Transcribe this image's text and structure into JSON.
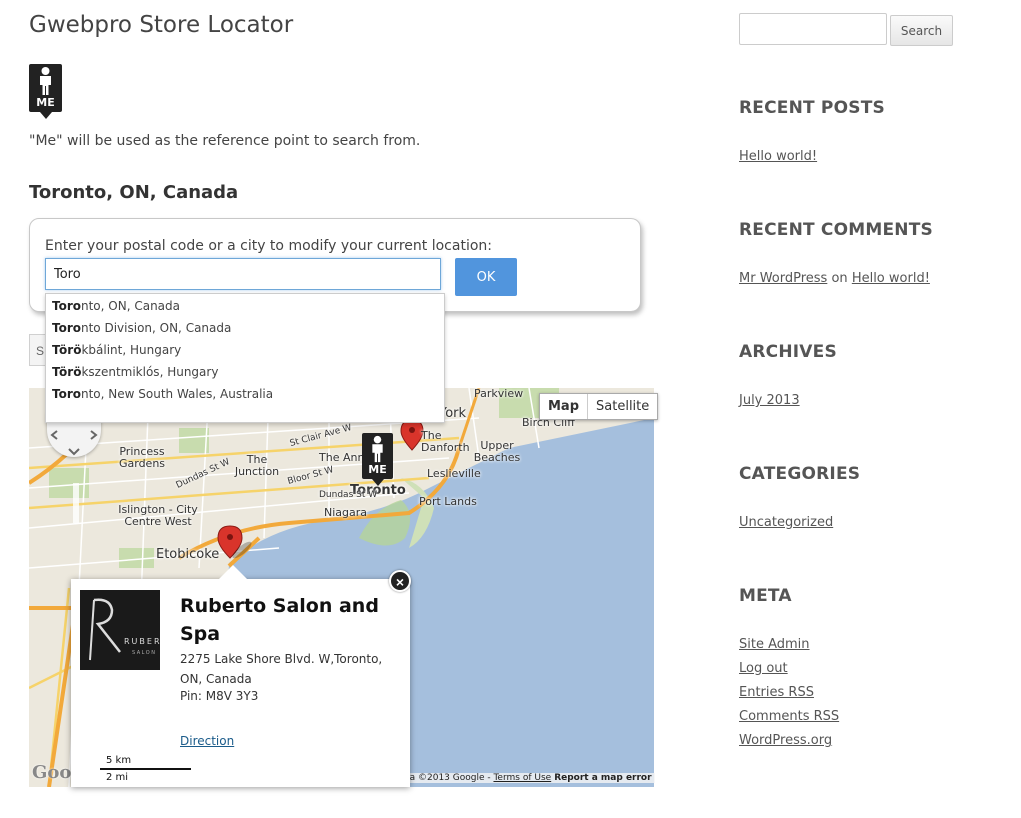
{
  "site": {
    "title": "Gwebpro Store Locator"
  },
  "me_marker": {
    "label": "ME"
  },
  "note": "\"Me\" will be used as the reference point to search from.",
  "location": {
    "title": "Toronto, ON, Canada",
    "prompt": "Enter your postal code or a city to modify your current location:",
    "input_value": "Toro",
    "ok_label": "OK",
    "hidden_button_label": "S"
  },
  "suggestions": [
    {
      "match": "Toro",
      "rest": "nto, ON, Canada"
    },
    {
      "match": "Toro",
      "rest": "nto Division, ON, Canada"
    },
    {
      "match": "Törö",
      "rest": "kbálint, Hungary"
    },
    {
      "match": "Törö",
      "rest": "kszentmiklós, Hungary"
    },
    {
      "match": "Toro",
      "rest": "nto, New South Wales, Australia"
    }
  ],
  "map": {
    "type_map": "Map",
    "type_satellite": "Satellite",
    "places": {
      "parkview": "Parkview",
      "york": "York",
      "the_danforth": "The Danforth",
      "birch_cliff": "Birch Cliff",
      "upper_beaches": "Upper Beaches",
      "leslieville": "Leslieville",
      "the_annex": "The Annex",
      "toronto": "Toronto",
      "port_lands": "Port Lands",
      "niagara": "Niagara",
      "princess_gardens": "Princess Gardens",
      "the_junction": "The Junction",
      "islington": "Islington - City Centre West",
      "etobicoke": "Etobicoke",
      "st_clair": "St Clair Ave W",
      "dundas_st_w": "Dundas St W",
      "bloor_st_w": "Bloor St W",
      "dundas_st_w2": "Dundas St W"
    },
    "attribution": "Map data ©2013 Google - ",
    "terms": "Terms of Use",
    "report": "Report a map error",
    "google_logo": "Google",
    "scale_km": "5 km",
    "scale_mi": "2 mi"
  },
  "info_window": {
    "title": "Ruberto Salon and Spa",
    "address": "2275 Lake Shore Blvd. W,Toronto, ON, Canada",
    "pin": "Pin: M8V 3Y3",
    "direction": "Direction",
    "logo_text": "RUBER",
    "logo_sub": "SALON",
    "close": "×"
  },
  "sidebar": {
    "search_button": "Search",
    "recent_posts": {
      "title": "RECENT POSTS",
      "items": [
        "Hello world!"
      ]
    },
    "recent_comments": {
      "title": "RECENT COMMENTS",
      "author": "Mr WordPress",
      "on": "on",
      "post": "Hello world!"
    },
    "archives": {
      "title": "ARCHIVES",
      "items": [
        "July 2013"
      ]
    },
    "categories": {
      "title": "CATEGORIES",
      "items": [
        "Uncategorized"
      ]
    },
    "meta": {
      "title": "META",
      "items": [
        "Site Admin",
        "Log out",
        "Entries RSS",
        "Comments RSS",
        "WordPress.org"
      ]
    }
  },
  "colors": {
    "accent": "#5195dd",
    "marker_red": "#d9342b",
    "water": "#a5bfdd",
    "road": "#f5b84a"
  }
}
